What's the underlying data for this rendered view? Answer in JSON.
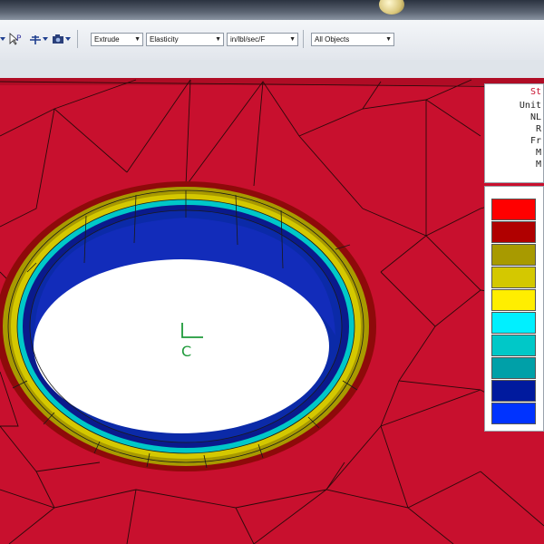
{
  "toolbar": {
    "tool_icons": [
      "dropdown-arrow-icon",
      "pointer-p-icon",
      "pan-tool-icon",
      "dropdown-arrow-icon",
      "camera-icon",
      "dropdown-arrow-icon"
    ],
    "p_label": "P",
    "dropdowns": [
      {
        "id": "feature",
        "value": "Extrude"
      },
      {
        "id": "property",
        "value": "Elasticity"
      },
      {
        "id": "units",
        "value": "in/lbl/sec/F"
      },
      {
        "id": "filter",
        "value": "All Objects"
      }
    ]
  },
  "viewport": {
    "axis_label": "C",
    "background_color": "#c8102e",
    "mesh_color": "#2a0a0a"
  },
  "legend": {
    "info_lines": [
      "St",
      "Unit",
      "NL",
      "R",
      "Fr",
      "M",
      "M"
    ],
    "color_scale": [
      "#ff0000",
      "#b00000",
      "#a89a00",
      "#d4c800",
      "#ffee00",
      "#00f0ff",
      "#00c8c8",
      "#00a0a8",
      "#001a9e",
      "#0033ff"
    ]
  }
}
